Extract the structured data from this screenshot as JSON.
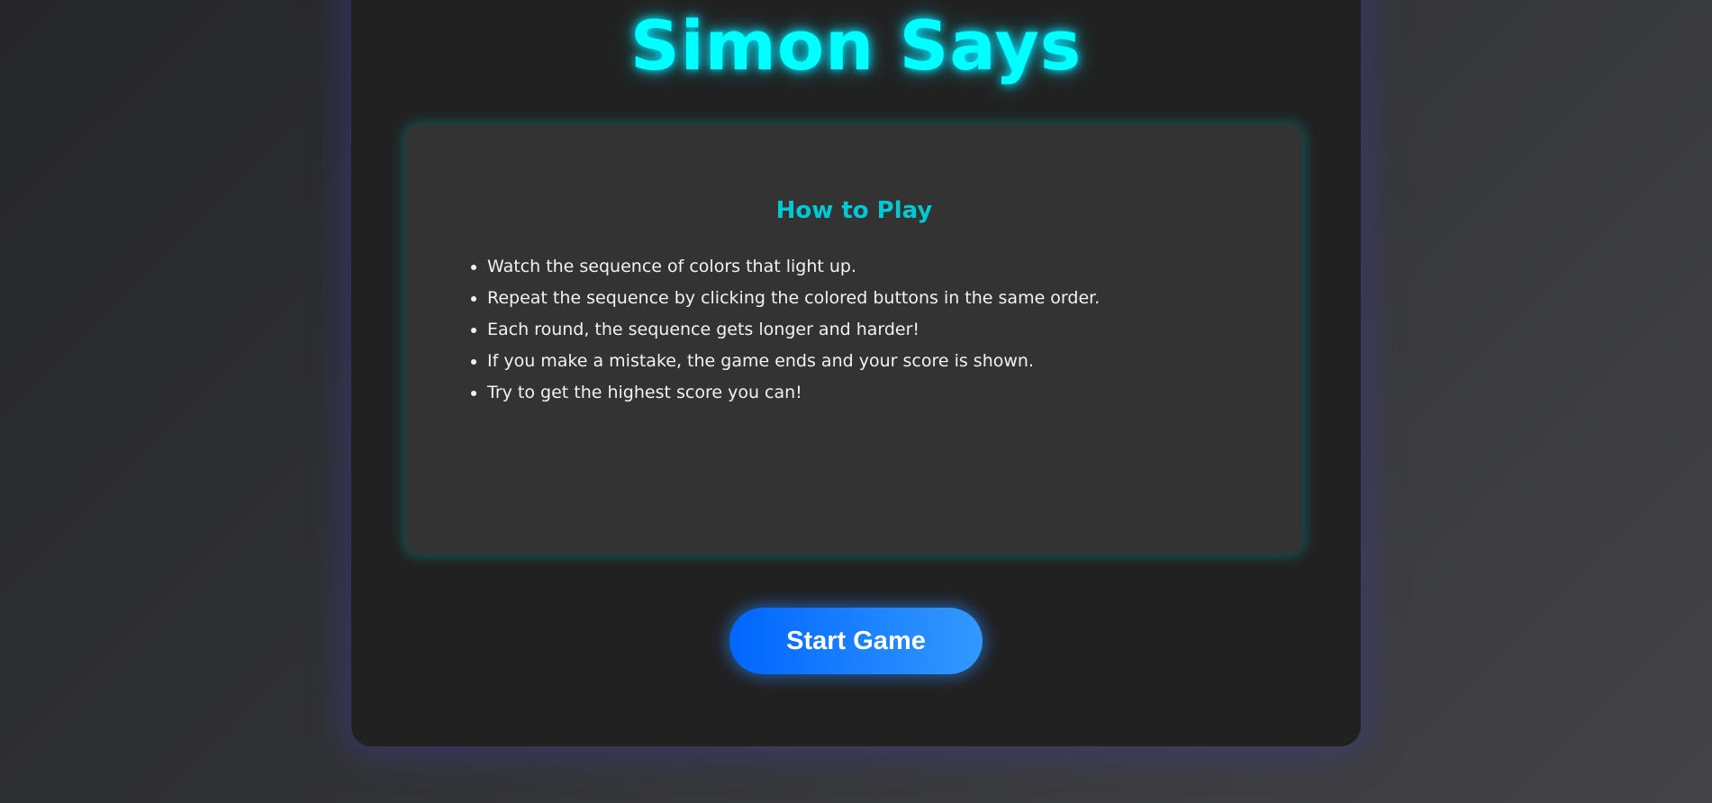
{
  "title": "Simon Says",
  "how_to_play": {
    "heading": "How to Play",
    "items": [
      "Watch the sequence of colors that light up.",
      "Repeat the sequence by clicking the colored buttons in the same order.",
      "Each round, the sequence gets longer and harder!",
      "If you make a mistake, the game ends and your score is shown.",
      "Try to get the highest score you can!"
    ]
  },
  "start_button": "Start Game",
  "colors": {
    "title": "#00ffff",
    "heading": "#00c8d2",
    "button_start": "#0066ff",
    "button_end": "#3399ff"
  }
}
